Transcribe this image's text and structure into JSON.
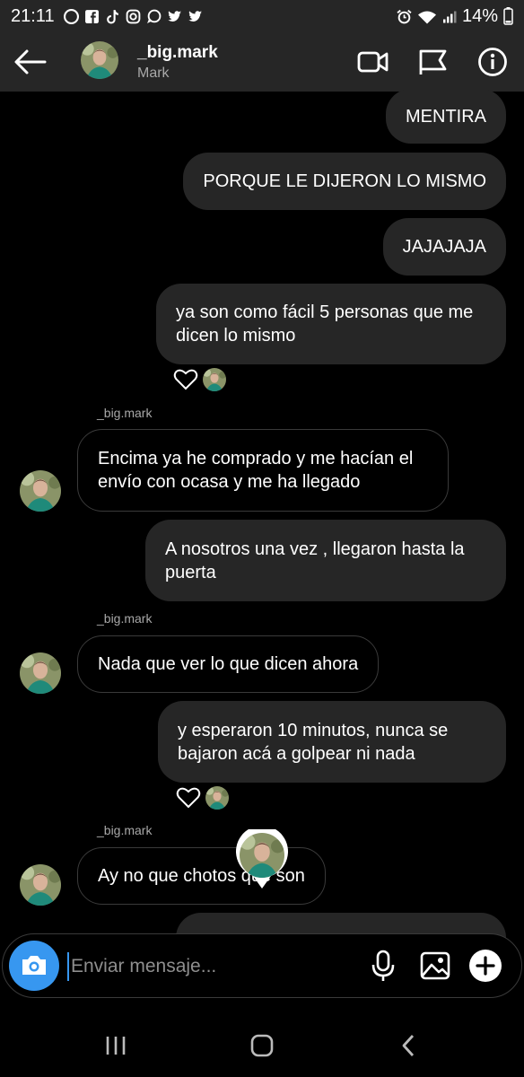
{
  "status_bar": {
    "time": "21:11",
    "battery": "14%"
  },
  "header": {
    "username": "_big.mark",
    "full_name": "Mark"
  },
  "messages": [
    {
      "text": "MENTIRA"
    },
    {
      "text": "PORQUE LE DIJERON LO MISMO"
    },
    {
      "text": "JAJAJAJA"
    },
    {
      "text": "ya son como fácil 5 personas que me dicen lo mismo"
    },
    {
      "sender": "_big.mark",
      "text": "Encima ya he comprado y me hacían el envío con ocasa y me ha llegado"
    },
    {
      "text": "A nosotros una vez , llegaron hasta la puerta"
    },
    {
      "sender": "_big.mark",
      "text": "Nada que ver lo que dicen ahora"
    },
    {
      "text": "y esperaron 10 minutos, nunca se bajaron acá a golpear ni nada"
    },
    {
      "sender": "_big.mark",
      "text": "Ay no que chotos que son"
    }
  ],
  "composer": {
    "placeholder": "Enviar mensaje..."
  },
  "colors": {
    "accent": "#3797f0",
    "bubble": "#262626",
    "bar": "#262626",
    "muted": "#a8a8a8"
  }
}
